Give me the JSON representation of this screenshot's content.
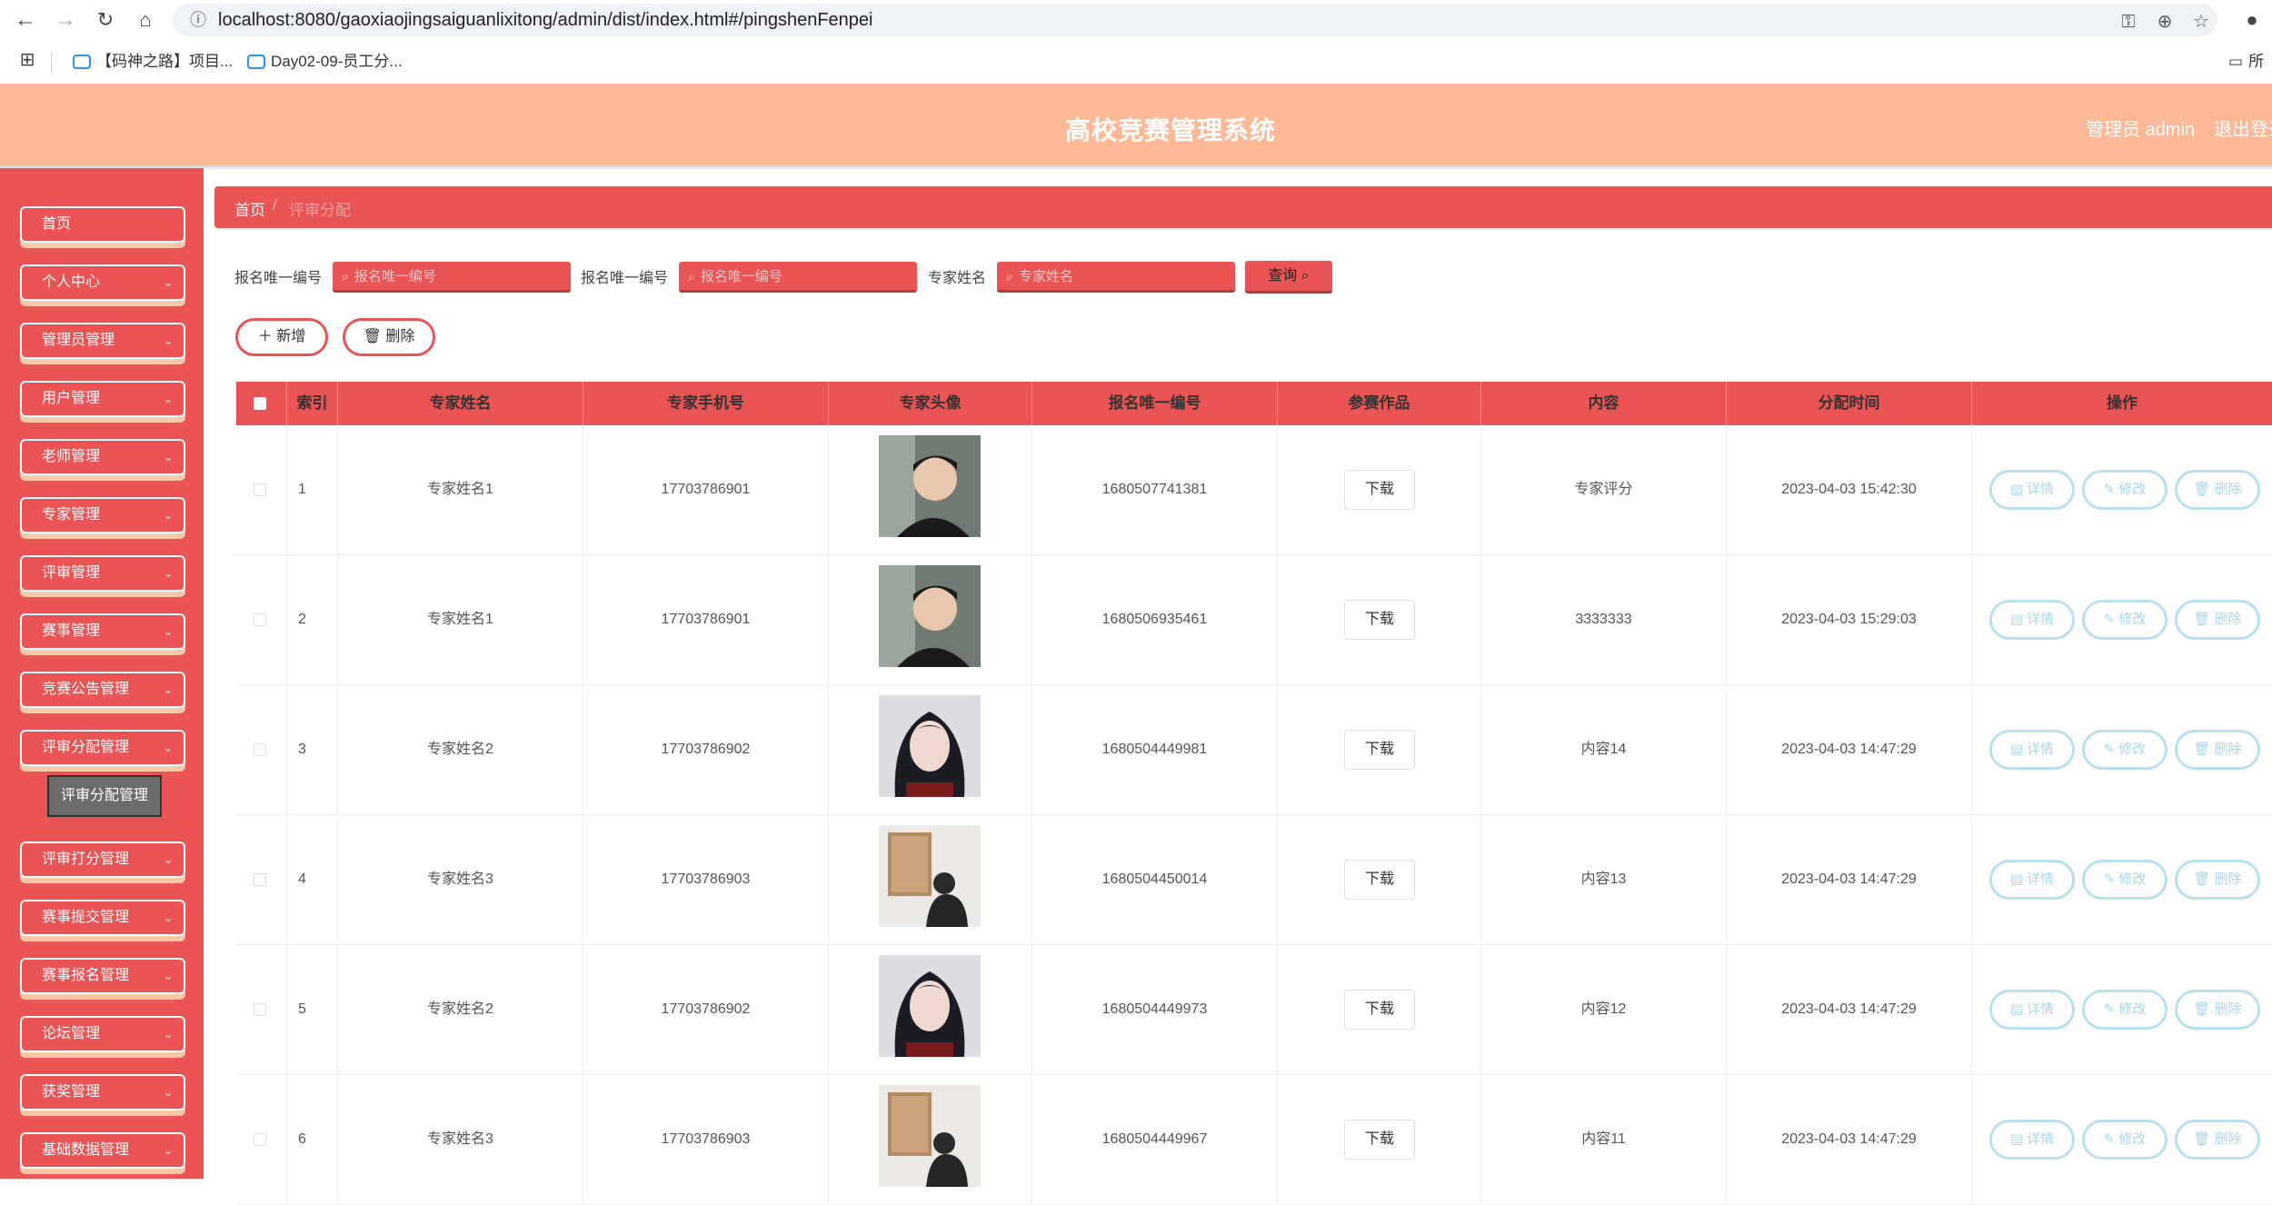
{
  "browser": {
    "url": "localhost:8080/gaoxiaojingsaiguanlixitong/admin/dist/index.html#/pingshenFenpei",
    "bookmarks": [
      "【码神之路】项目...",
      "Day02-09-员工分..."
    ],
    "bookmark_folder": "所"
  },
  "header": {
    "title": "高校竞赛管理系统",
    "admin": "管理员 admin",
    "logout": "退出登录"
  },
  "sidebar": {
    "items": [
      {
        "label": "首页",
        "arrow": ""
      },
      {
        "label": "个人中心",
        "arrow": "⌄"
      },
      {
        "label": "管理员管理",
        "arrow": "⌄"
      },
      {
        "label": "用户管理",
        "arrow": "⌄"
      },
      {
        "label": "老师管理",
        "arrow": "⌄"
      },
      {
        "label": "专家管理",
        "arrow": "⌄"
      },
      {
        "label": "评审管理",
        "arrow": "⌄"
      },
      {
        "label": "赛事管理",
        "arrow": "⌄"
      },
      {
        "label": "竞赛公告管理",
        "arrow": "⌄"
      },
      {
        "label": "评审分配管理",
        "arrow": "⌄"
      },
      {
        "label": "评审打分管理",
        "arrow": "⌄"
      },
      {
        "label": "赛事提交管理",
        "arrow": "⌄"
      },
      {
        "label": "赛事报名管理",
        "arrow": "⌄"
      },
      {
        "label": "论坛管理",
        "arrow": "⌄"
      },
      {
        "label": "获奖管理",
        "arrow": "⌄"
      },
      {
        "label": "基础数据管理",
        "arrow": "⌄"
      }
    ],
    "submenu": "评审分配管理"
  },
  "breadcrumb": {
    "home": "首页",
    "sep": "/",
    "current": "评审分配"
  },
  "search": {
    "fields": [
      {
        "label": "报名唯一编号",
        "placeholder": "报名唯一编号"
      },
      {
        "label": "报名唯一编号",
        "placeholder": "报名唯一编号"
      },
      {
        "label": "专家姓名",
        "placeholder": "专家姓名"
      }
    ],
    "query": "查询"
  },
  "actions": {
    "add": "新增",
    "delete": "删除"
  },
  "table": {
    "headers": [
      "",
      "索引",
      "专家姓名",
      "专家手机号",
      "专家头像",
      "报名唯一编号",
      "参赛作品",
      "内容",
      "分配时间",
      "操作"
    ],
    "download_label": "下载",
    "op_labels": {
      "detail": "详情",
      "edit": "修改",
      "delete": "删除"
    },
    "rows": [
      {
        "index": "1",
        "name": "专家姓名1",
        "phone": "17703786901",
        "avatar": "male",
        "regno": "1680507741381",
        "content": "专家评分",
        "time": "2023-04-03 15:42:30"
      },
      {
        "index": "2",
        "name": "专家姓名1",
        "phone": "17703786901",
        "avatar": "male",
        "regno": "1680506935461",
        "content": "3333333",
        "time": "2023-04-03 15:29:03"
      },
      {
        "index": "3",
        "name": "专家姓名2",
        "phone": "17703786902",
        "avatar": "female",
        "regno": "1680504449981",
        "content": "内容14",
        "time": "2023-04-03 14:47:29"
      },
      {
        "index": "4",
        "name": "专家姓名3",
        "phone": "17703786903",
        "avatar": "gallery",
        "regno": "1680504450014",
        "content": "内容13",
        "time": "2023-04-03 14:47:29"
      },
      {
        "index": "5",
        "name": "专家姓名2",
        "phone": "17703786902",
        "avatar": "female",
        "regno": "1680504449973",
        "content": "内容12",
        "time": "2023-04-03 14:47:29"
      },
      {
        "index": "6",
        "name": "专家姓名3",
        "phone": "17703786903",
        "avatar": "gallery",
        "regno": "1680504449967",
        "content": "内容11",
        "time": "2023-04-03 14:47:29"
      }
    ]
  }
}
